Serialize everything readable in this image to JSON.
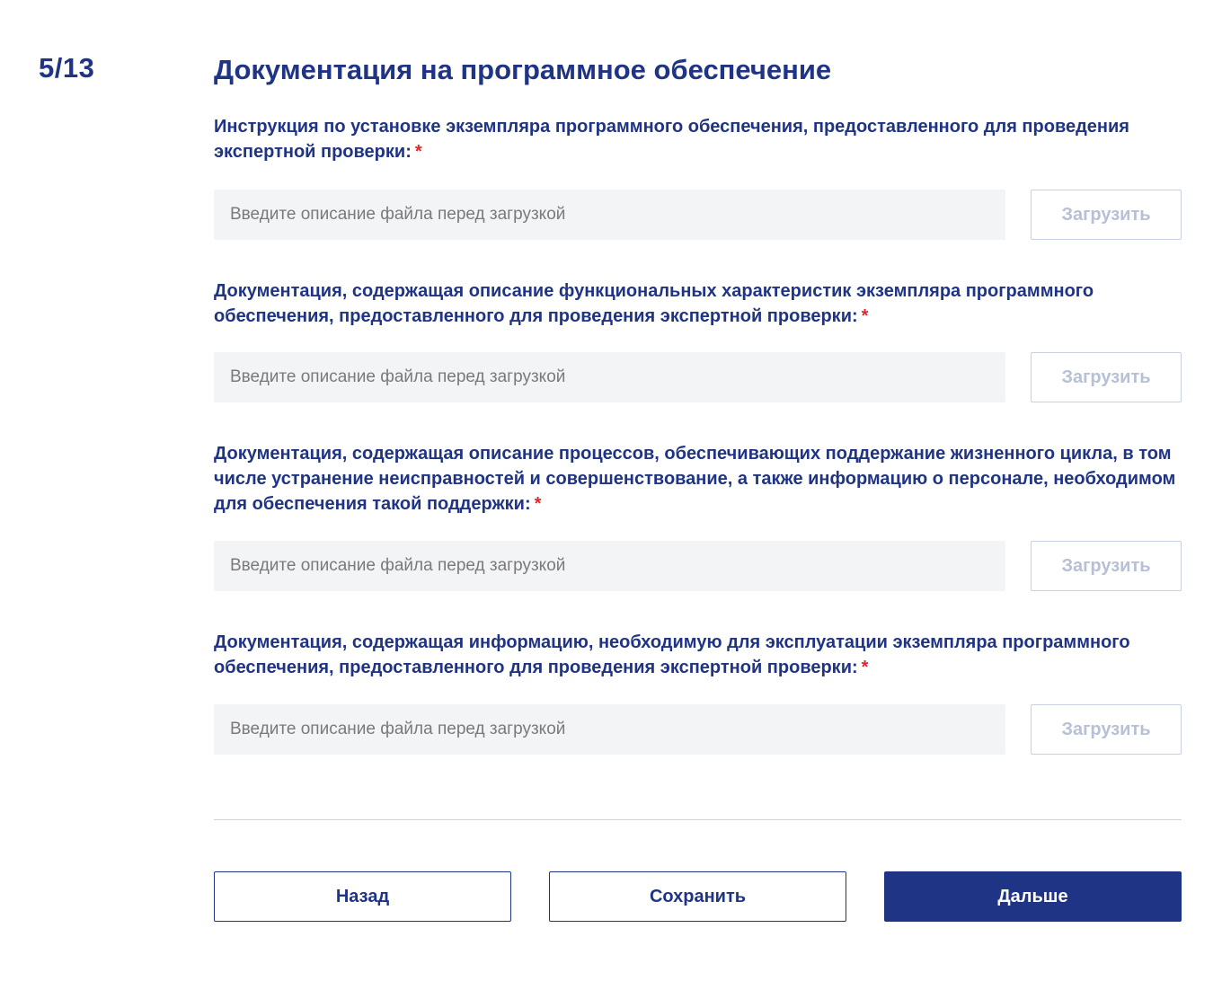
{
  "header": {
    "step": "5/13",
    "title": "Документация на программное обеспечение"
  },
  "required_mark": "*",
  "fields": [
    {
      "label": "Инструкция по установке экземпляра программного обеспечения, предоставленного для проведения экспертной проверки:",
      "placeholder": "Введите описание файла перед загрузкой",
      "value": "",
      "upload_label": "Загрузить"
    },
    {
      "label": "Документация, содержащая описание функциональных характеристик экземпляра программного обеспечения, предоставленного для проведения экспертной проверки:",
      "placeholder": "Введите описание файла перед загрузкой",
      "value": "",
      "upload_label": "Загрузить"
    },
    {
      "label": "Документация, содержащая описание процессов, обеспечивающих поддержание жизненного цикла, в том числе устранение неисправностей и совершенствование, а также информацию о персонале, необходимом для обеспечения такой поддержки:",
      "placeholder": "Введите описание файла перед загрузкой",
      "value": "",
      "upload_label": "Загрузить"
    },
    {
      "label": "Документация, содержащая информацию, необходимую для эксплуатации экземпляра программного обеспечения, предоставленного для проведения экспертной проверки:",
      "placeholder": "Введите описание файла перед загрузкой",
      "value": "",
      "upload_label": "Загрузить"
    }
  ],
  "footer": {
    "back_label": "Назад",
    "save_label": "Сохранить",
    "next_label": "Дальше"
  },
  "colors": {
    "primary": "#1f3484",
    "required": "#e3262c",
    "input_background": "#f3f4f6",
    "disabled_text": "#b8c0d6"
  }
}
